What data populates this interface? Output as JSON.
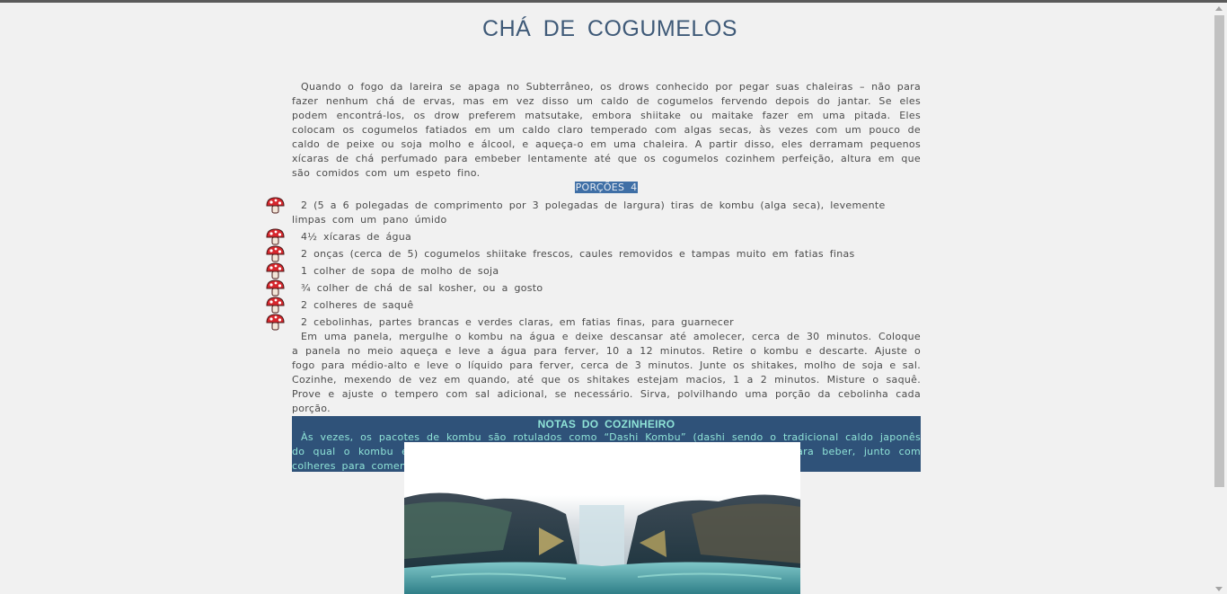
{
  "recipe": {
    "title": "CHÁ DE COGUMELOS",
    "intro": "Quando o fogo da lareira se apaga no Subterrâneo, os drows conhecido por pegar suas chaleiras – não para fazer nenhum chá de ervas, mas em vez disso um caldo de cogumelos fervendo depois do jantar. Se eles podem encontrá-los, os drow preferem matsutake, embora shiitake ou maitake fazer em uma pitada. Eles colocam os cogumelos fatiados em um caldo claro temperado com algas secas, às vezes com um pouco de caldo de peixe ou soja molho e álcool, e aqueça-o em uma chaleira. A partir disso, eles derramam pequenos xícaras de chá perfumado para embeber lentamente até que os cogumelos cozinhem perfeição, altura em que são comidos com um espeto fino.",
    "servings": "PORÇÕES 4",
    "ingredients": [
      "2 (5 a 6 polegadas de comprimento por 3 polegadas de largura) tiras de kombu (alga seca), levemente limpas com um pano úmido",
      "4½ xícaras de água",
      "2 onças (cerca de 5) cogumelos shiitake frescos, caules removidos e tampas muito em fatias finas",
      "1 colher de sopa de molho de soja",
      "¾ colher de chá de sal kosher, ou a gosto",
      "2 colheres de saquê",
      "2 cebolinhas, partes brancas e verdes claras, em fatias finas, para guarnecer"
    ],
    "bullet_icon": "mushroom-icon",
    "method": "Em uma panela, mergulhe o kombu na água e deixe descansar até amolecer, cerca de 30 minutos. Coloque a panela no meio aqueça e leve a água para ferver, 10 a 12 minutos. Retire o kombu e descarte. Ajuste o fogo para médio-alto e leve o líquido para ferver, cerca de 3 minutos. Junte os shitakes, molho de soja e sal. Cozinhe, mexendo de vez em quando, até que os shitakes estejam macios, 1 a 2 minutos. Misture o saquê. Prove e ajuste o tempero com sal adicional, se necessário. Sirva, polvilhando uma porção da cebolinha cada porção.",
    "notes": {
      "title": "NOTAS DO COZINHEIRO",
      "text": "Às vezes, os pacotes de kombu são rotulados como “Dashi Kombu” (dashi sendo o tradicional caldo japonês do qual o kombu é o principal componente). Sirva este saboroso chá em canecas, para beber, junto com colheres para comendo os cogumelos e cebolinha."
    }
  },
  "colors": {
    "title": "#3f5a78",
    "highlight": "#3f6fa6",
    "notes_bg": "#2f5279",
    "notes_text": "#8fe3d7",
    "mushroom_cap": "#d7262c"
  }
}
